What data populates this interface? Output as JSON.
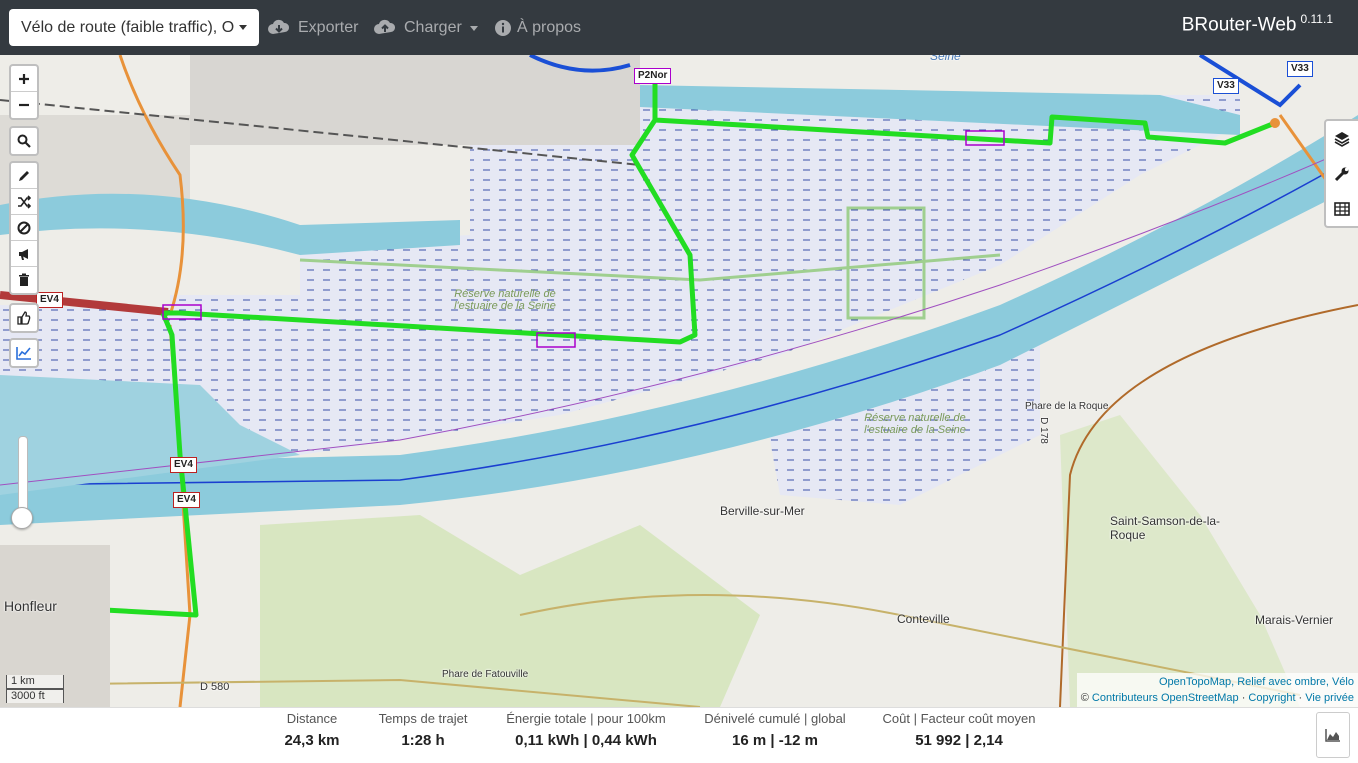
{
  "navbar": {
    "profile": "Vélo de route (faible traffic), O",
    "export_label": "Exporter",
    "load_label": "Charger",
    "about_label": "À propos",
    "brand": "BRouter-Web",
    "version": "0.11.1"
  },
  "map": {
    "labels": {
      "honfleur": "Honfleur",
      "berville": "Berville-sur-Mer",
      "conteville": "Conteville",
      "saint_samson": "Saint-Samson-de-la-Roque",
      "marais": "Marais-Vernier",
      "phare_roque": "Phare de la Roque",
      "phare_fatouville": "Phare de Fatouville",
      "d580": "D 580",
      "d178": "D 178",
      "seine": "Seine"
    },
    "reserve_label": "Réserve naturelle de l'estuaire de la Seine",
    "shields": {
      "ev4": "EV4",
      "p2nor": "P2Nor",
      "v33": "V33"
    },
    "colors": {
      "route": "#22dd22",
      "water": "#8ccbdc",
      "marsh": "#e6e8f4"
    }
  },
  "scale": {
    "km": "1 km",
    "ft": "3000 ft"
  },
  "attribution": {
    "line1": "OpenTopoMap, Relief avec ombre, Vélo",
    "copyright_sign": "©",
    "contributors": "Contributeurs OpenStreetMap",
    "copyright": "Copyright",
    "privacy": "Vie privée"
  },
  "stats": {
    "distance_label": "Distance",
    "distance_value": "24,3 km",
    "time_label": "Temps de trajet",
    "time_value": "1:28 h",
    "energy_label": "Énergie totale | pour 100km",
    "energy_value": "0,11 kWh | 0,44 kWh",
    "elevation_label": "Dénivelé cumulé | global",
    "elevation_value": "16 m | -12 m",
    "cost_label": "Coût | Facteur coût moyen",
    "cost_value": "51 992 | 2,14"
  }
}
